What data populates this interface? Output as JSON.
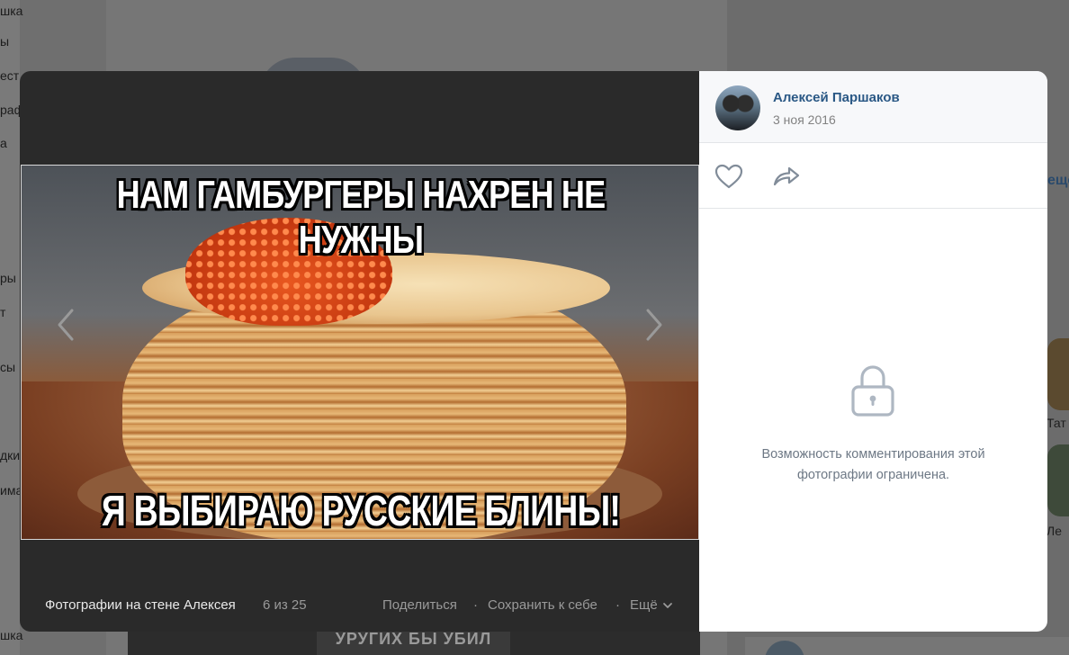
{
  "background": {
    "left_menu_fragments": [
      "шка",
      "ы",
      "ест",
      "раф",
      "а",
      "ры",
      "т",
      "сы",
      "дки",
      "има",
      "шка"
    ],
    "right_link_fragment": "ещё",
    "friend_fragments": [
      "Тат",
      "Ле"
    ],
    "bottom_strip_text": "УРУГИХ БЫ УБИЛ"
  },
  "viewer": {
    "photo": {
      "caption_top": "НАМ ГАМБУРГЕРЫ НАХРЕН НЕ НУЖНЫ",
      "caption_bottom": "Я ВЫБИРАЮ РУССКИЕ БЛИНЫ!"
    },
    "footer": {
      "album_title": "Фотографии на стене Алексея",
      "counter": "6 из 25",
      "share_label": "Поделиться",
      "separator": "·",
      "save_label": "Сохранить к себе",
      "more_label": "Ещё"
    },
    "icons": {
      "prev": "chevron-left-icon",
      "next": "chevron-right-icon",
      "like": "heart-icon",
      "share": "share-arrow-icon",
      "lock": "lock-icon",
      "more": "chevron-down-icon"
    }
  },
  "side_panel": {
    "author_name": "Алексей Паршаков",
    "date": "3 ноя 2016",
    "comments_closed_text": "Возможность комментирования этой фотографии ограничена."
  },
  "colors": {
    "link": "#2a5885",
    "icon": "#818c99",
    "muted_text": "#6d7885",
    "dark_pane": "#2a2a2a"
  }
}
